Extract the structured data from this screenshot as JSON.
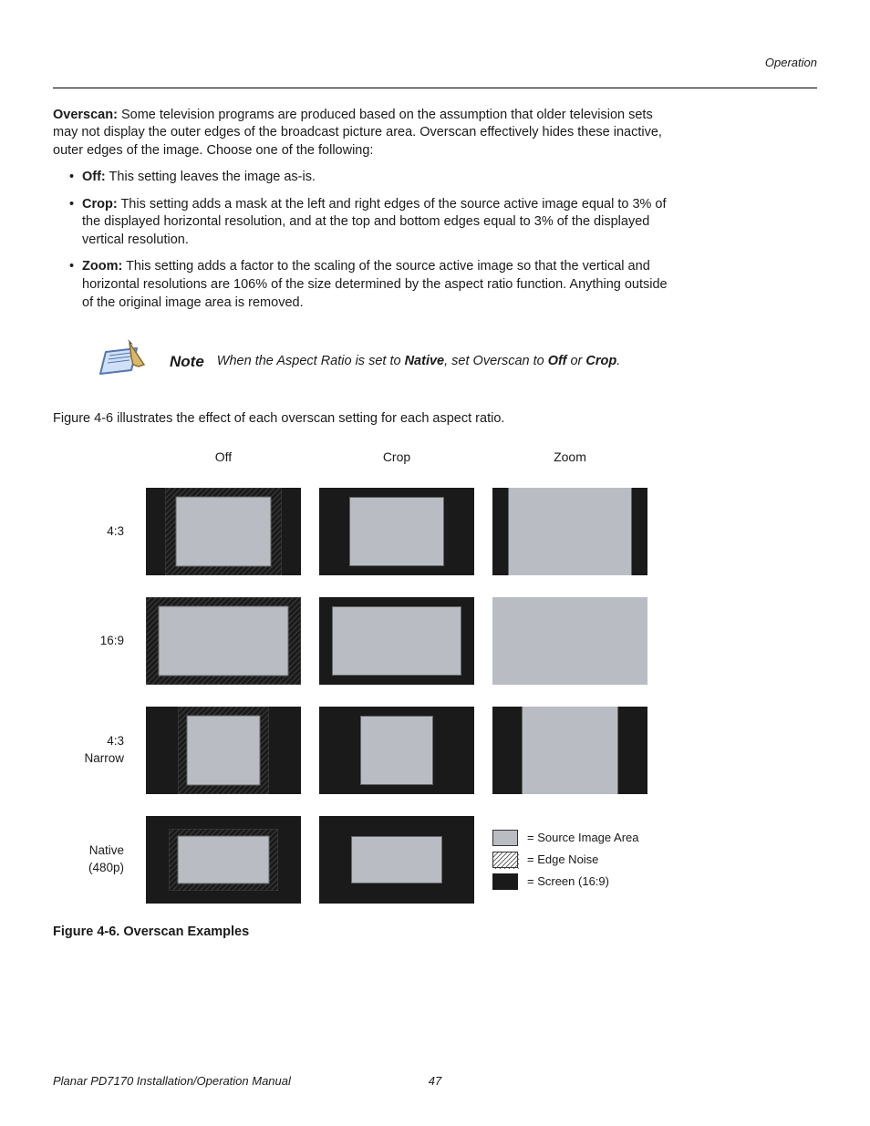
{
  "header": {
    "section": "Operation"
  },
  "overscan": {
    "title_word": "Overscan:",
    "intro": "Some television programs are produced based on the assumption that older television sets may not display the outer edges of the broadcast picture area. Overscan effectively hides these inactive, outer edges of the image. Choose one of the following:",
    "bullets": {
      "off_label": "Off:",
      "off_text": "This setting leaves the image as-is.",
      "crop_label": "Crop:",
      "crop_text": "This setting adds a mask at the left and right edges of the source active image equal to 3% of the displayed horizontal resolution, and at the top and bottom edges equal to 3% of the displayed vertical resolution.",
      "zoom_label": "Zoom:",
      "zoom_text": "This setting adds a factor to the scaling of the source active image so that the vertical and horizontal resolutions are 106% of the size determined by the aspect ratio function. Anything outside of the original image area is removed."
    }
  },
  "note": {
    "label": "Note",
    "pre": "When the Aspect Ratio is set to ",
    "bold1": "Native",
    "mid": ", set Overscan to ",
    "bold2": "Off",
    "mid2": " or ",
    "bold3": "Crop",
    "post": "."
  },
  "fig_intro": "Figure 4-6 illustrates the effect of each overscan setting for each aspect ratio.",
  "grid": {
    "cols": {
      "off": "Off",
      "crop": "Crop",
      "zoom": "Zoom"
    },
    "rows": {
      "r1": "4:3",
      "r2": "16:9",
      "r3a": "4:3",
      "r3b": "Narrow",
      "r4a": "Native",
      "r4b": "(480p)"
    }
  },
  "legend": {
    "src": "= Source Image Area",
    "edge": "= Edge Noise",
    "screen": "= Screen (16:9)"
  },
  "caption": "Figure 4-6. Overscan Examples",
  "footer": {
    "title": "Planar PD7170 Installation/Operation Manual",
    "page": "47"
  }
}
